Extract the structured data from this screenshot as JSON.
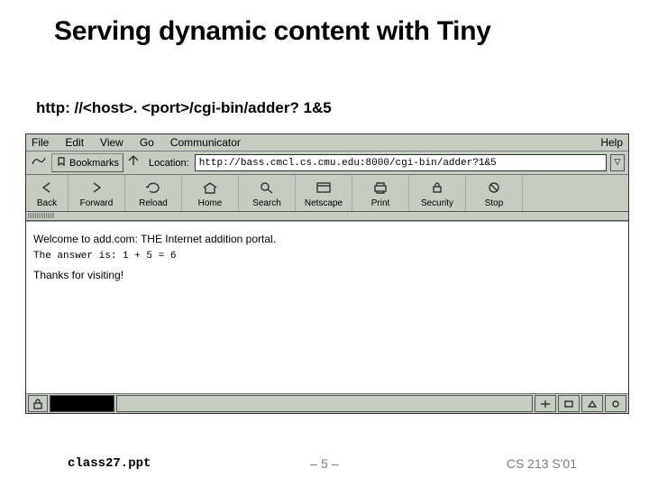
{
  "title": "Serving dynamic content with Tiny",
  "url_example": "http: //<host>. <port>/cgi-bin/adder? 1&5",
  "browser": {
    "menubar": {
      "items": [
        "File",
        "Edit",
        "View",
        "Go",
        "Communicator"
      ],
      "help": "Help"
    },
    "bookmarks_label": "Bookmarks",
    "location_label": "Location:",
    "location_value": "http://bass.cmcl.cs.cmu.edu:8000/cgi-bin/adder?1&5",
    "dropdown_glyph": "▽",
    "toolbar": [
      {
        "label": "Back"
      },
      {
        "label": "Forward"
      },
      {
        "label": "Reload"
      },
      {
        "label": "Home"
      },
      {
        "label": "Search"
      },
      {
        "label": "Netscape"
      },
      {
        "label": "Print"
      },
      {
        "label": "Security"
      },
      {
        "label": "Stop"
      }
    ],
    "page": {
      "welcome": "Welcome to add.com: THE Internet addition portal.",
      "answer": "The answer is: 1 + 5 = 6",
      "thanks": "Thanks for visiting!"
    }
  },
  "footer": {
    "left": "class27.ppt",
    "center": "– 5 –",
    "right": "CS 213 S'01"
  }
}
